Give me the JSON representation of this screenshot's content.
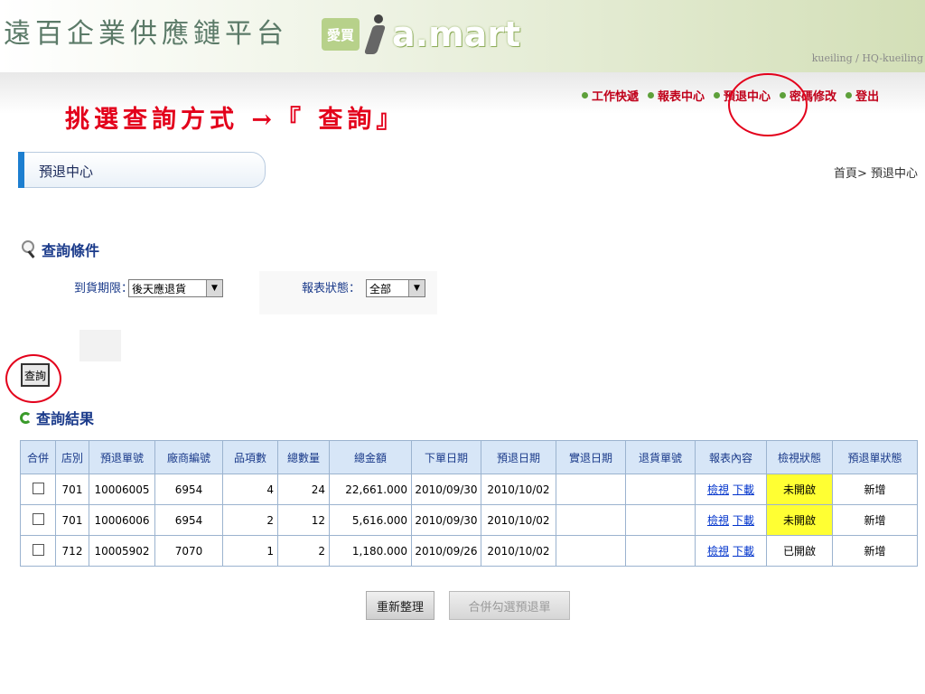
{
  "header": {
    "site_title": "遠百企業供應鏈平台",
    "logo_mark": "愛買",
    "logo_text": "a.mart",
    "user_info": "kueiling / HQ-kueiling"
  },
  "annotation": "挑選查詢方式 →『 查詢』",
  "nav": {
    "items": [
      "工作快遞",
      "報表中心",
      "預退中心",
      "密碼修改",
      "登出"
    ]
  },
  "section_tab": "預退中心",
  "breadcrumb": "首頁> 預退中心",
  "query": {
    "title": "查詢條件",
    "arrival_label": "到貨期限：",
    "arrival_value": "後天應退貨",
    "status_label": "報表狀態：",
    "status_value": "全部",
    "submit_label": "查詢"
  },
  "results": {
    "title": "查詢結果",
    "headers": [
      "合併",
      "店別",
      "預退單號",
      "廠商編號",
      "品項數",
      "總數量",
      "總金額",
      "下單日期",
      "預退日期",
      "實退日期",
      "退貨單號",
      "報表內容",
      "檢視狀態",
      "預退單狀態"
    ],
    "rows": [
      {
        "store": "701",
        "order_no": "10006005",
        "vendor": "6954",
        "items": "4",
        "qty": "24",
        "amount": "22,661.000",
        "order_date": "2010/09/30",
        "return_date": "2010/10/02",
        "actual_date": "",
        "return_no": "",
        "view": "檢視",
        "download": "下載",
        "view_status": "未開啟",
        "order_status": "新增"
      },
      {
        "store": "701",
        "order_no": "10006006",
        "vendor": "6954",
        "items": "2",
        "qty": "12",
        "amount": "5,616.000",
        "order_date": "2010/09/30",
        "return_date": "2010/10/02",
        "actual_date": "",
        "return_no": "",
        "view": "檢視",
        "download": "下載",
        "view_status": "未開啟",
        "order_status": "新增"
      },
      {
        "store": "712",
        "order_no": "10005902",
        "vendor": "7070",
        "items": "1",
        "qty": "2",
        "amount": "1,180.000",
        "order_date": "2010/09/26",
        "return_date": "2010/10/02",
        "actual_date": "",
        "return_no": "",
        "view": "檢視",
        "download": "下載",
        "view_status": "已開啟",
        "order_status": "新增"
      }
    ]
  },
  "buttons": {
    "reset": "重新整理",
    "merge": "合併勾選預退單"
  },
  "colors": {
    "annotation_red": "#e3001b",
    "nav_red": "#c0001a",
    "highlight_yellow": "#ffff33",
    "header_blue": "#d7e6f7"
  }
}
